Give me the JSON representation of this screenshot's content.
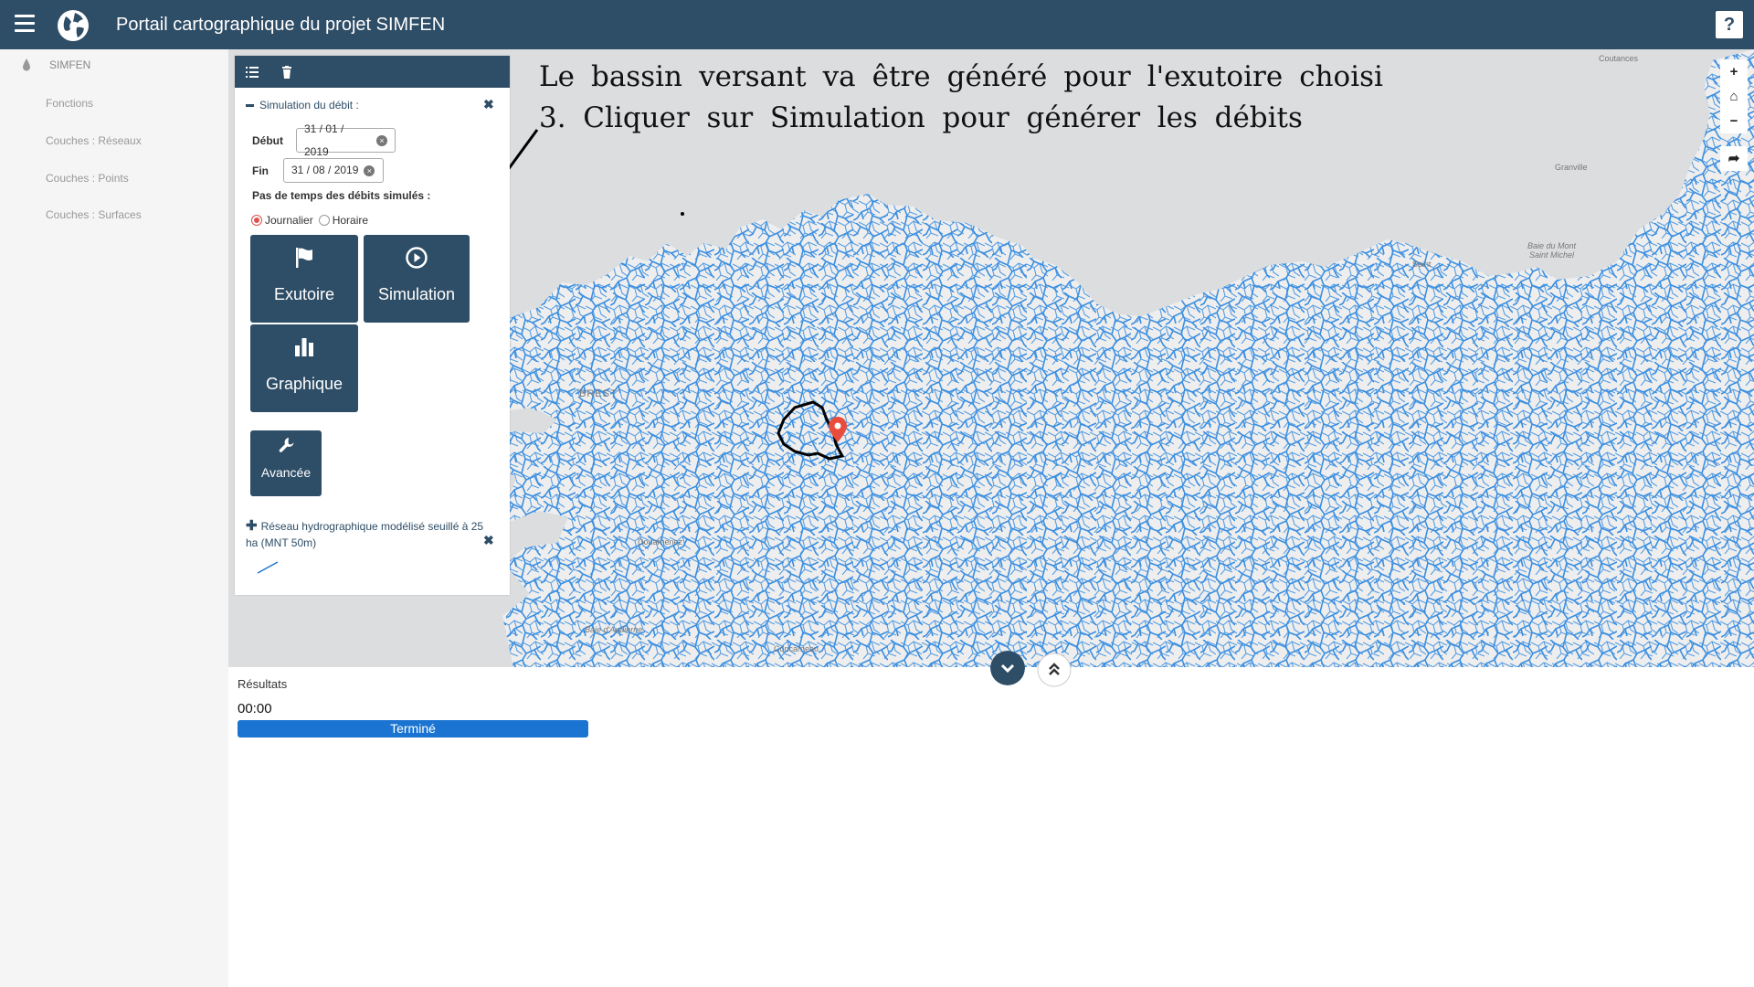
{
  "header": {
    "title": "Portail cartographique du projet SIMFEN",
    "help_label": "?"
  },
  "sidebar": {
    "brand": "SIMFEN",
    "items": [
      {
        "label": "Fonctions"
      },
      {
        "label": "Couches : Réseaux"
      },
      {
        "label": "Couches : Points"
      },
      {
        "label": "Couches : Surfaces"
      }
    ]
  },
  "panel": {
    "section_title": "Simulation du débit :",
    "start_label": "Début",
    "start_value": "31 / 01 / 2019",
    "end_label": "Fin",
    "end_value": "31 / 08 / 2019",
    "timestep_label": "Pas de temps des débits simulés :",
    "radio_daily": "Journalier",
    "radio_hourly": "Horaire",
    "selected_timestep": "Journalier",
    "tiles": {
      "outlet": "Exutoire",
      "simulation": "Simulation",
      "chart": "Graphique",
      "advanced": "Avancée"
    },
    "layer_name": "Réseau hydrographique modélisé seuillé à 25 ha (MNT 50m)"
  },
  "map": {
    "place_labels": [
      "Coutances",
      "Granville",
      "Baie du Mont",
      "Saint Michel",
      "Saint",
      "BREST",
      "Douarnenez",
      "Baie d'Audierne",
      "Concarneau"
    ],
    "river_color": "#3c8fe0",
    "land_color": "#eeeeee",
    "sea_color": "#dcdddf",
    "marker_color": "#e74c3c"
  },
  "map_controls": {
    "zoom_in": "+",
    "home": "⌂",
    "zoom_out": "−",
    "share": "➦"
  },
  "annotation": {
    "line1": [
      "Le",
      "bassin",
      "versant",
      "va",
      "être",
      "généré",
      "pour",
      "l'exutoire",
      "choisi"
    ],
    "line2": [
      "3.",
      "Cliquer",
      "sur",
      "Simulation",
      "pour",
      "générer",
      "les",
      "débits"
    ]
  },
  "results": {
    "label": "Résultats",
    "time": "00:00",
    "progress_percent": 100,
    "status": "Terminé"
  },
  "colors": {
    "primary": "#2e4d66",
    "progress": "#1b74d1"
  }
}
